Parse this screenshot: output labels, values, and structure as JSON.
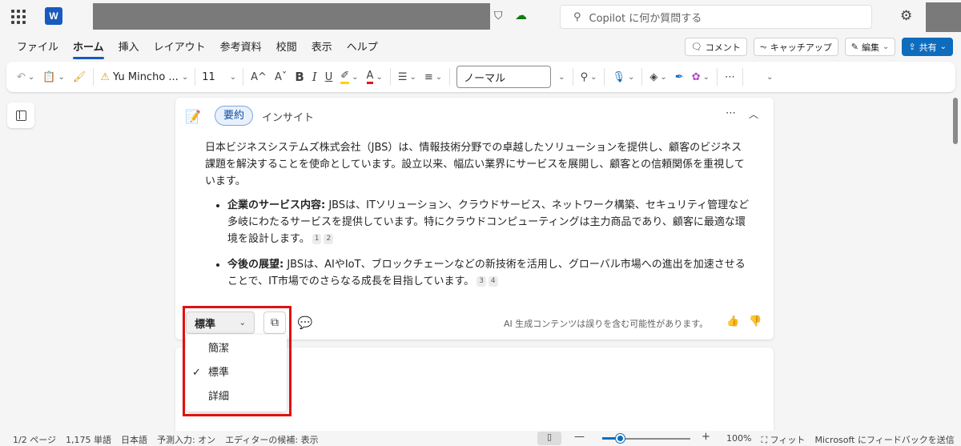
{
  "titlebar": {
    "search_placeholder": "Copilot に何か質問する",
    "app_letter": "W"
  },
  "tabs": [
    "ファイル",
    "ホーム",
    "挿入",
    "レイアウト",
    "参考資料",
    "校閲",
    "表示",
    "ヘルプ"
  ],
  "active_tab": "ホーム",
  "ribbon_right": {
    "comment": "コメント",
    "catchup": "キャッチアップ",
    "edit": "編集",
    "share": "共有"
  },
  "toolbar": {
    "font_name": "Yu Mincho ...",
    "font_size": "11",
    "style_name": "ノーマル",
    "grow_font": "A^",
    "shrink_font": "Aˇ",
    "bold": "B",
    "italic": "I",
    "underline": "U"
  },
  "card": {
    "tab_active": "要約",
    "tab_other": "インサイト",
    "intro": "日本ビジネスシステムズ株式会社（JBS）は、情報技術分野での卓越したソリューションを提供し、顧客のビジネス課題を解決することを使命としています。設立以来、幅広い業界にサービスを展開し、顧客との信頼関係を重視しています。",
    "bullets": [
      {
        "heading": "企業のサービス内容:",
        "text": " JBSは、ITソリューション、クラウドサービス、ネットワーク構築、セキュリティ管理など多岐にわたるサービスを提供しています。特にクラウドコンピューティングは主力商品であり、顧客に最適な環境を設計します。",
        "cites": [
          "1",
          "2"
        ]
      },
      {
        "heading": "今後の展望:",
        "text": " JBSは、AIやIoT、ブロックチェーンなどの新技術を活用し、グローバル市場への進出を加速させることで、IT市場でのさらなる成長を目指しています。",
        "cites": [
          "3",
          "4"
        ]
      }
    ],
    "length_selected": "標準",
    "ai_note": "AI 生成コンテンツは誤りを含む可能性があります。"
  },
  "dropdown": {
    "options": [
      "簡潔",
      "標準",
      "詳細"
    ],
    "checked": "標準"
  },
  "statusbar": {
    "page": "1/2 ページ",
    "words": "1,175 単語",
    "language": "日本語",
    "predictive": "予測入力: オン",
    "editor": "エディターの候補: 表示",
    "zoom": "100%",
    "zoom_level": 0.2,
    "fit": "フィット",
    "feedback": "Microsoft にフィードバックを送信"
  },
  "colors": {
    "accent": "#185abd",
    "share": "#0f6cbd",
    "highlight_box": "#e21111"
  }
}
